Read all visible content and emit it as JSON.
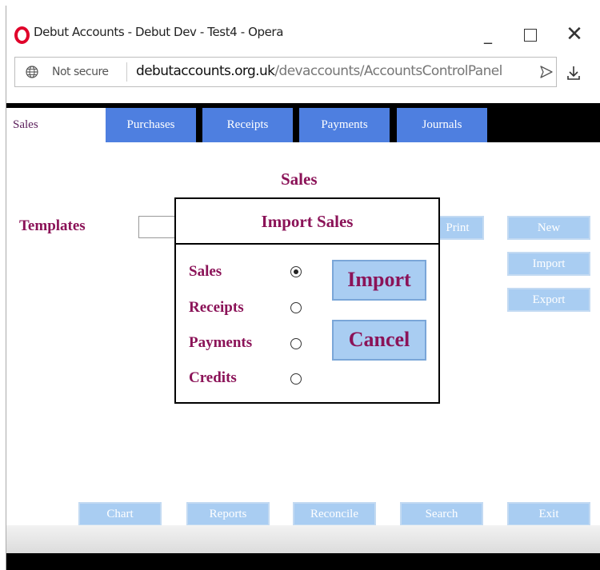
{
  "window": {
    "title": "Debut Accounts - Debut Dev - Test4 - Opera",
    "minimize_glyph": "_",
    "close_glyph": "✕"
  },
  "address_bar": {
    "security_label": "Not secure",
    "url_host": "debutaccounts.org.uk",
    "url_path": "/devaccounts/AccountsControlPanel"
  },
  "tabs": [
    {
      "label": "Sales",
      "active": true
    },
    {
      "label": "Purchases",
      "active": false
    },
    {
      "label": "Receipts",
      "active": false
    },
    {
      "label": "Payments",
      "active": false
    },
    {
      "label": "Journals",
      "active": false
    }
  ],
  "page": {
    "title": "Sales",
    "templates_label": "Templates"
  },
  "side_buttons": {
    "print": "Print",
    "new": "New",
    "import": "Import",
    "export": "Export"
  },
  "bottom_buttons": {
    "chart": "Chart",
    "reports": "Reports",
    "reconcile": "Reconcile",
    "search": "Search",
    "exit": "Exit"
  },
  "modal": {
    "title": "Import Sales",
    "options": [
      {
        "label": "Sales",
        "selected": true
      },
      {
        "label": "Receipts",
        "selected": false
      },
      {
        "label": "Payments",
        "selected": false
      },
      {
        "label": "Credits",
        "selected": false
      }
    ],
    "import_button": "Import",
    "cancel_button": "Cancel"
  },
  "colors": {
    "accent_text": "#8b1358",
    "tab_blue": "#4e7fe0",
    "button_blue": "#a9cdf2",
    "opera_red": "#e0002a"
  },
  "icons": [
    "opera-logo-icon",
    "globe-icon",
    "send-icon",
    "download-icon",
    "minimize-icon",
    "maximize-icon",
    "close-icon"
  ]
}
